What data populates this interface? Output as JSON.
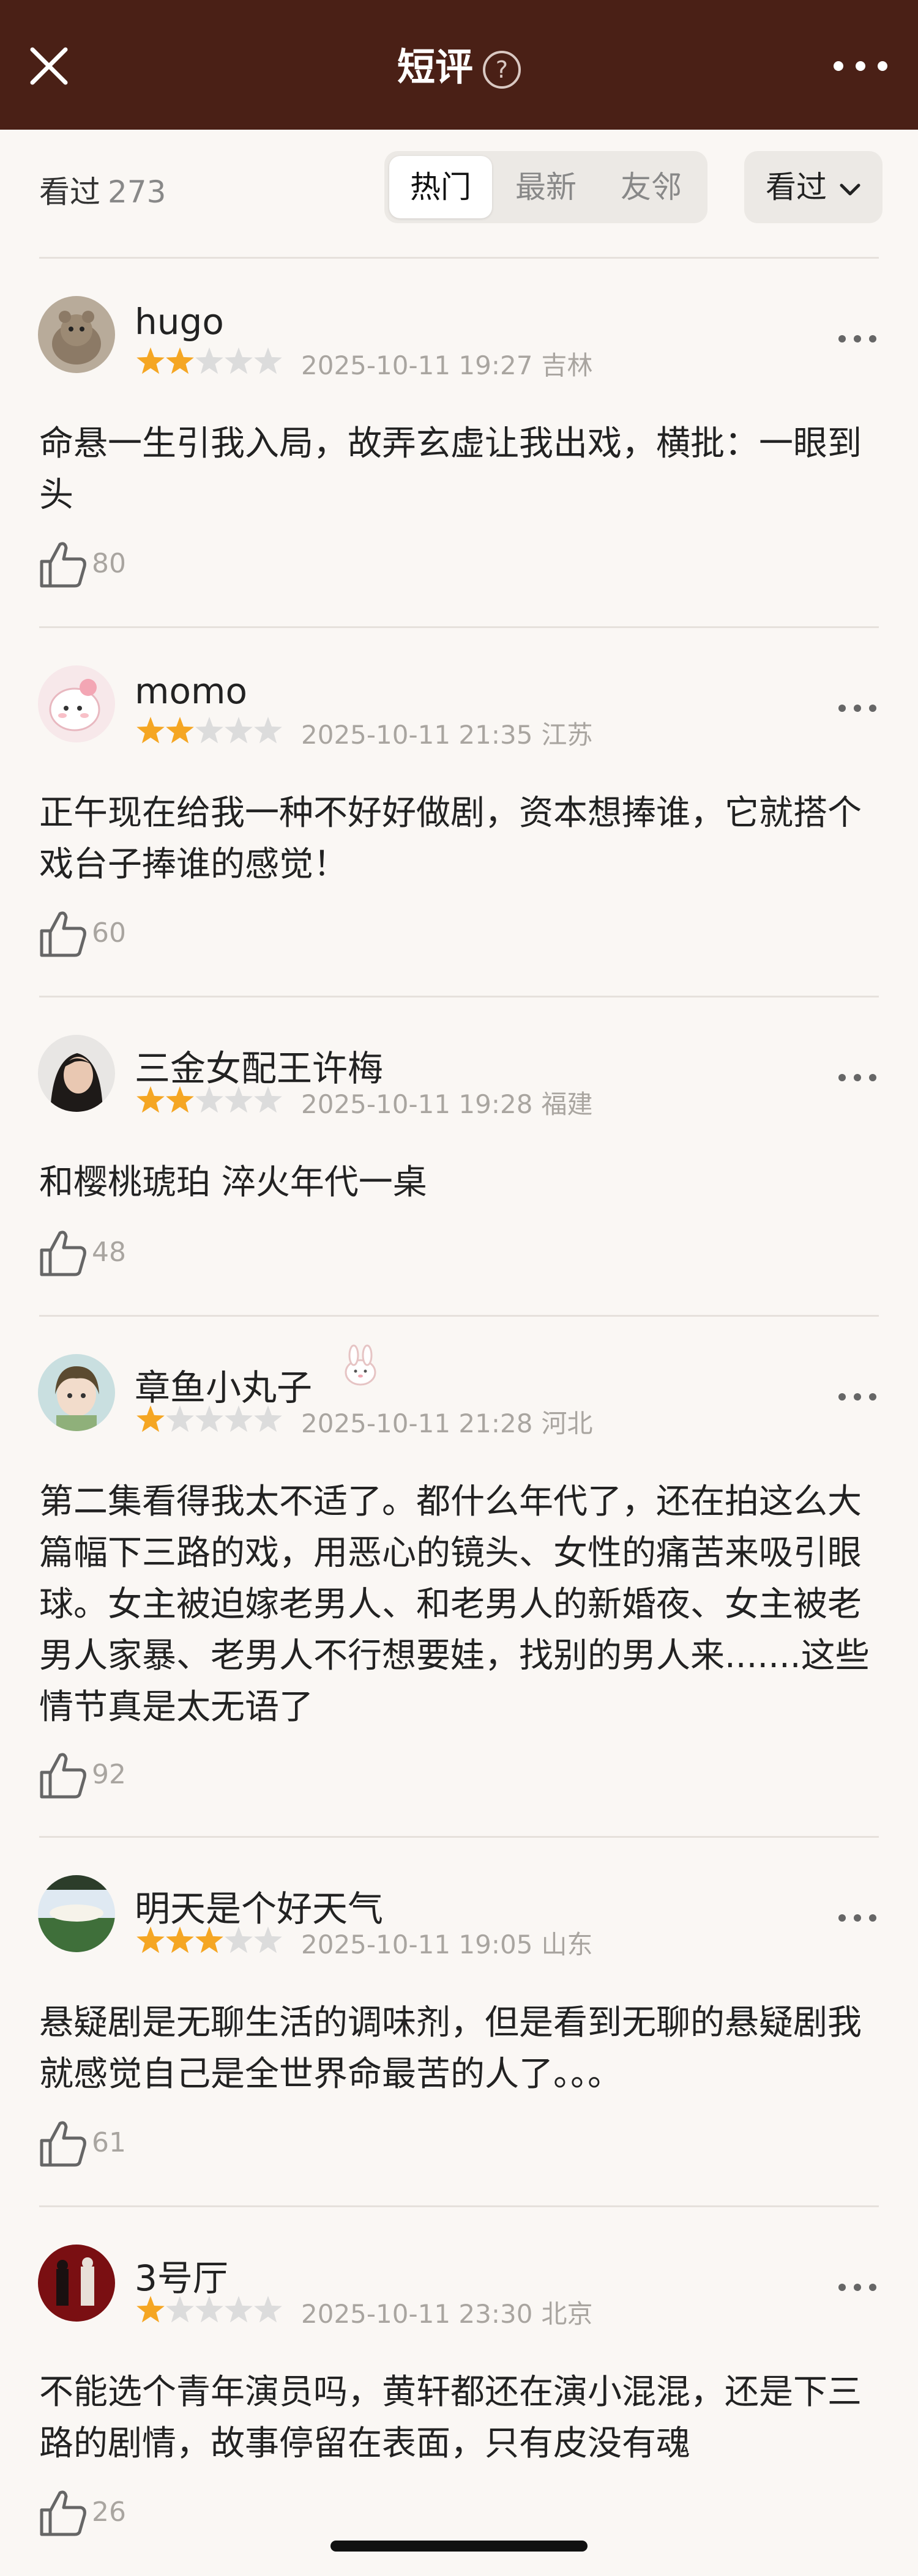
{
  "header": {
    "title": "短评",
    "help_glyph": "?"
  },
  "filter": {
    "watched_label": "看过",
    "watched_count": "273",
    "tabs": [
      {
        "label": "热门",
        "active": true
      },
      {
        "label": "最新",
        "active": false
      },
      {
        "label": "友邻",
        "active": false
      }
    ],
    "sort_label": "看过"
  },
  "comments": [
    {
      "name": "hugo",
      "stars": 2,
      "time": "2025-10-11 19:27",
      "location": "吉林",
      "text": "命悬一生引我入局，故弄玄虚让我出戏，横批：一眼到头",
      "likes": "80",
      "avatar": "animal-avatar"
    },
    {
      "name": "momo",
      "stars": 2,
      "time": "2025-10-11 21:35",
      "location": "江苏",
      "text": "正午现在给我一种不好好做剧，资本想捧谁，它就搭个戏台子捧谁的感觉！",
      "likes": "60",
      "avatar": "cartoon-avatar"
    },
    {
      "name": "三金女配王许梅",
      "stars": 2,
      "time": "2025-10-11 19:28",
      "location": "福建",
      "text": "和樱桃琥珀 淬火年代一桌",
      "likes": "48",
      "avatar": "portrait-avatar"
    },
    {
      "name": "章鱼小丸子",
      "stars": 1,
      "time": "2025-10-11 21:28",
      "location": "河北",
      "text": "第二集看得我太不适了。都什么年代了，还在拍这么大篇幅下三路的戏，用恶心的镜头、女性的痛苦来吸引眼球。女主被迫嫁老男人、和老男人的新婚夜、女主被老男人家暴、老男人不行想要娃，找别的男人来.......这些情节真是太无语了",
      "likes": "92",
      "avatar": "anime-avatar",
      "badge": "rabbit-badge-icon"
    },
    {
      "name": "明天是个好天气",
      "stars": 3,
      "time": "2025-10-11 19:05",
      "location": "山东",
      "text": "悬疑剧是无聊生活的调味剂，但是看到无聊的悬疑剧我就感觉自己是全世界命最苦的人了。。。",
      "likes": "61",
      "avatar": "landscape-avatar"
    },
    {
      "name": "3号厅",
      "stars": 1,
      "time": "2025-10-11 23:30",
      "location": "北京",
      "text": "不能选个青年演员吗，黄轩都还在演小混混，还是下三路的剧情，故事停留在表面，只有皮没有魂",
      "likes": "26",
      "avatar": "theater-avatar"
    }
  ],
  "colors": {
    "header_bg": "#4a2016",
    "star_filled": "#f5a623",
    "star_empty": "#dcdcdc",
    "page_bg": "#faf7f4"
  }
}
